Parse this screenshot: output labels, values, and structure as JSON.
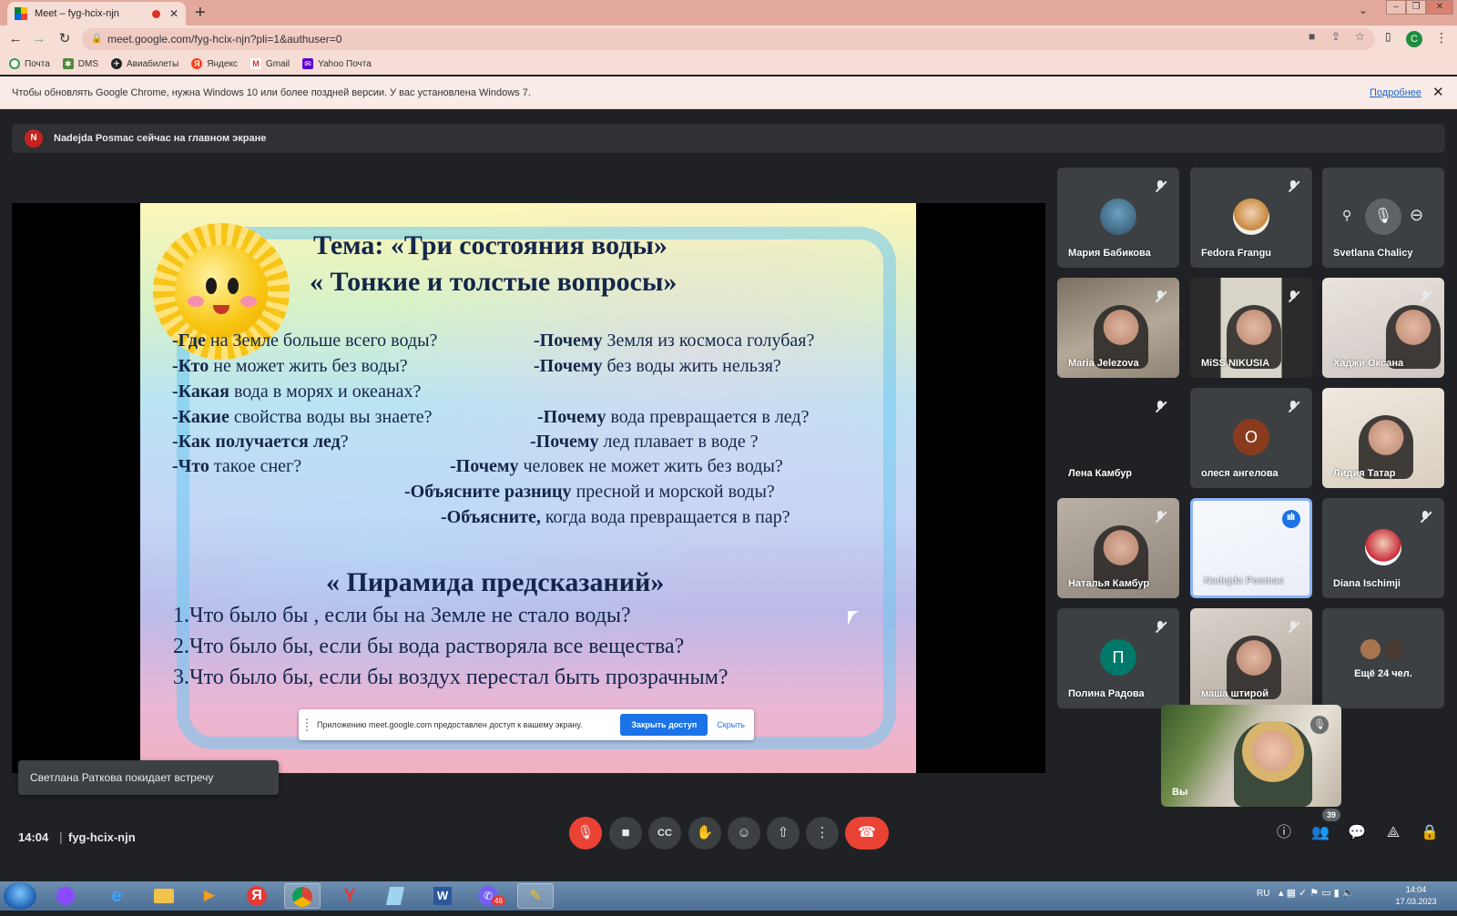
{
  "browser": {
    "tab_title": "Meet – fyg-hcix-njn",
    "url": "meet.google.com/fyg-hcix-njn?pli=1&authuser=0",
    "profile_initial": "C",
    "bookmarks": [
      "Почта",
      "DMS",
      "Авиабилеты",
      "Яндекс",
      "Gmail",
      "Yahoo Почта"
    ],
    "infobar_text": "Чтобы обновлять Google Chrome, нужна Windows 10 или более поздней версии. У вас установлена Windows 7.",
    "infobar_link": "Подробнее"
  },
  "meet": {
    "presenter_initial": "N",
    "presenter_banner": "Nadejda Posmac сейчас на главном экране",
    "slide": {
      "title1": "Тема:   «Три состояния воды»",
      "title2": "« Тонкие и толстые вопросы»",
      "left_questions": [
        {
          "bold": "-Где",
          "rest": " на Земле больше всего воды?"
        },
        {
          "bold": "-Кто",
          "rest": " не может жить без воды?"
        },
        {
          "bold": "-Какая",
          "rest": " вода в морях и океанах?"
        },
        {
          "bold": "-Какие",
          "rest": " свойства воды вы знаете?"
        },
        {
          "bold": " -Как получается лед",
          "rest": "?"
        },
        {
          "bold": "-Что",
          "rest": " такое снег?"
        }
      ],
      "right_questions": [
        {
          "bold": "-Почему",
          "rest": " Земля из космоса голубая?"
        },
        {
          "bold": "-Почему",
          "rest": " без воды жить нельзя?"
        },
        {
          "bold": "-Почему",
          "rest": " вода превращается в лед?"
        },
        {
          "bold": "-Почему",
          "rest": " лед плавает в воде ?"
        },
        {
          "bold": "-Почему",
          "rest": " человек не может  жить без воды?"
        },
        {
          "bold": "-Объясните разницу",
          "rest": " пресной и   морской воды?"
        },
        {
          "bold": "-Объясните,",
          "rest": " когда вода превращается в пар?"
        }
      ],
      "pyramid_title": "« Пирамида предсказаний»",
      "pyramid_items": [
        "1.Что было бы , если бы на Земле не стало воды?",
        "2.Что было бы, если бы вода растворяла все вещества?",
        "3.Что было бы, если бы воздух перестал быть прозрачным?"
      ]
    },
    "share_bar": {
      "message": "Приложению meet.google.com предоставлен доступ к вашему экрану.",
      "stop_label": "Закрыть доступ",
      "hide_label": "Скрыть"
    },
    "participants": [
      {
        "name": "Мария Бабикова",
        "muted": true
      },
      {
        "name": "Fedora Frangu",
        "muted": true
      },
      {
        "name": "Svetlana Chalicy",
        "muted": false
      },
      {
        "name": "Maria Jelezova",
        "muted": true
      },
      {
        "name": "MiSS NIKUSIA",
        "muted": true
      },
      {
        "name": "Хаджи Оксана",
        "muted": true
      },
      {
        "name": "Лена Камбур",
        "muted": true
      },
      {
        "name": "олеся ангелова",
        "muted": true,
        "initial": "О",
        "color": "#8a3b1e"
      },
      {
        "name": "Лидия Татар",
        "muted": false
      },
      {
        "name": "Наталья Камбур",
        "muted": true
      },
      {
        "name": "Nadejda Posmac",
        "muted": false,
        "speaking": true
      },
      {
        "name": "Diana Ischimji",
        "muted": true
      },
      {
        "name": "Полина Радова",
        "muted": true,
        "initial": "П",
        "color": "#00796b"
      },
      {
        "name": "маша штирой",
        "muted": true
      }
    ],
    "more_label": "Ещё 24 чел.",
    "self_label": "Вы",
    "toast": "Светлана Раткова покидает встречу",
    "time": "14:04",
    "meeting_code": "fyg-hcix-njn",
    "people_count": "39"
  },
  "taskbar": {
    "language": "RU",
    "time": "14:04",
    "date": "17.03.2023",
    "viber_badge": "46"
  },
  "colors": {
    "meet_bg": "#202124",
    "tile_bg": "#3c4043",
    "danger": "#ea4335",
    "accent": "#1a73e8",
    "chrome_frame": "#e3a99c"
  }
}
